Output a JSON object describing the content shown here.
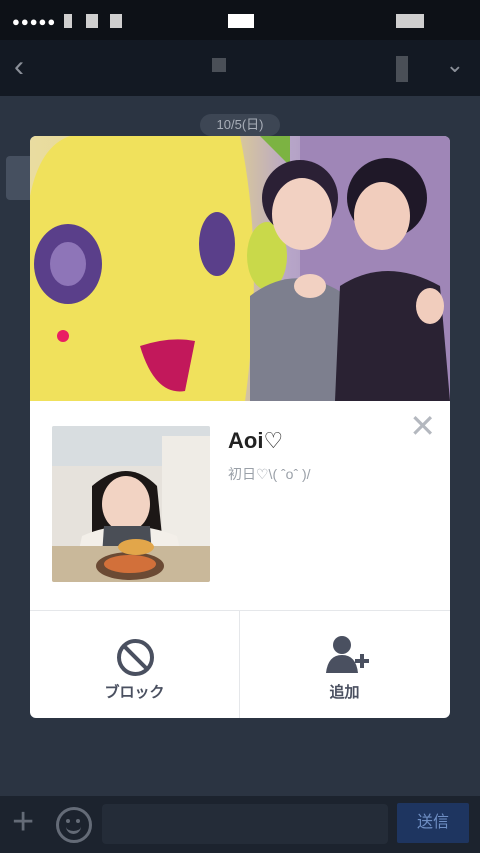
{
  "status_bar": {
    "signal": "●●●●●"
  },
  "chat": {
    "date": "10/5(日)"
  },
  "input_bar": {
    "send_label": "送信"
  },
  "profile": {
    "name": "Aoi♡",
    "status_message": "初日♡\\( ˆoˆ )/",
    "actions": {
      "block_label": "ブロック",
      "add_label": "追加"
    }
  },
  "colors": {
    "card_bg": "#ffffff",
    "icon": "#4a5060",
    "send": "#1e3560"
  }
}
